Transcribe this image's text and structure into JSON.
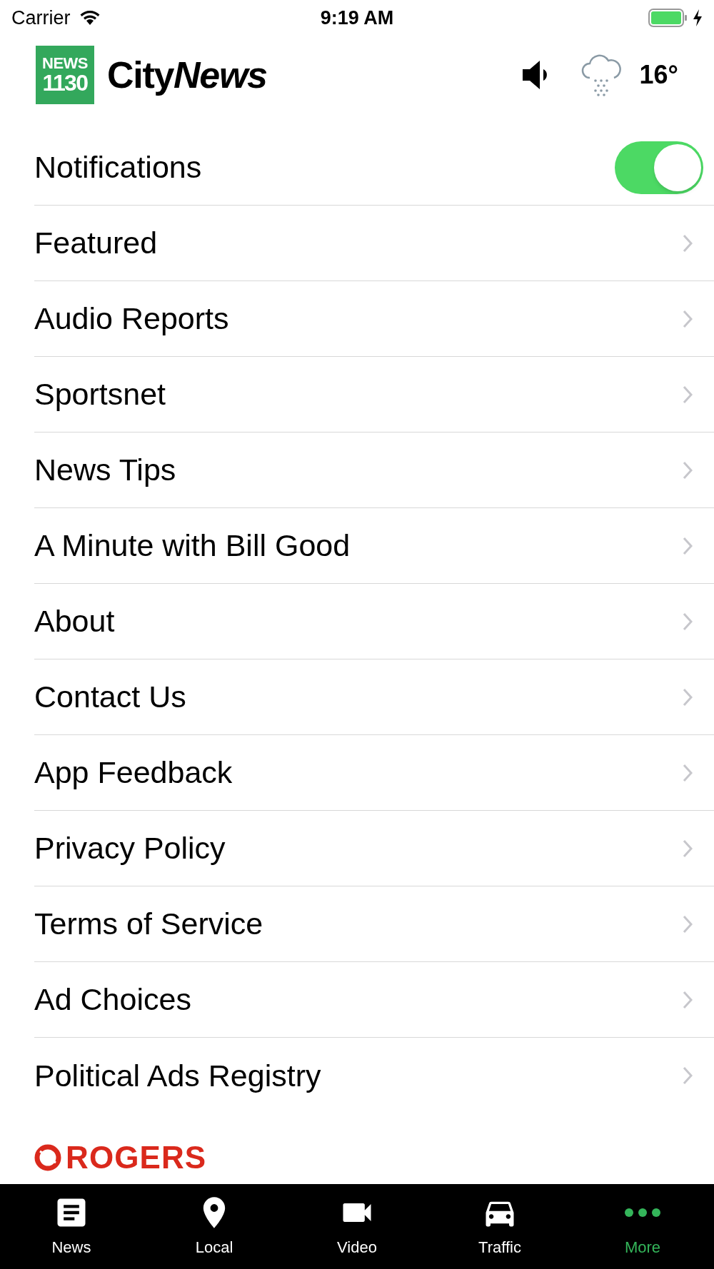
{
  "status_bar": {
    "carrier": "Carrier",
    "time": "9:19 AM"
  },
  "header": {
    "logo_badge": [
      "NEWS",
      "1130"
    ],
    "brand": [
      "City",
      "News"
    ],
    "temperature": "16°"
  },
  "settings": [
    {
      "kind": "toggle",
      "label": "Notifications",
      "on": true
    },
    {
      "kind": "link",
      "label": "Featured"
    },
    {
      "kind": "link",
      "label": "Audio Reports"
    },
    {
      "kind": "link",
      "label": "Sportsnet"
    },
    {
      "kind": "link",
      "label": "News Tips"
    },
    {
      "kind": "link",
      "label": "A Minute with Bill Good"
    },
    {
      "kind": "link",
      "label": "About"
    },
    {
      "kind": "link",
      "label": "Contact Us"
    },
    {
      "kind": "link",
      "label": "App Feedback"
    },
    {
      "kind": "link",
      "label": "Privacy Policy"
    },
    {
      "kind": "link",
      "label": "Terms of Service"
    },
    {
      "kind": "link",
      "label": "Ad Choices"
    },
    {
      "kind": "link",
      "label": "Political Ads Registry"
    }
  ],
  "sponsor": "ROGERS",
  "tabs": [
    {
      "kind": "news",
      "label": "News",
      "selected": false
    },
    {
      "kind": "local",
      "label": "Local",
      "selected": false
    },
    {
      "kind": "video",
      "label": "Video",
      "selected": false
    },
    {
      "kind": "traffic",
      "label": "Traffic",
      "selected": false
    },
    {
      "kind": "more",
      "label": "More",
      "selected": true
    }
  ]
}
